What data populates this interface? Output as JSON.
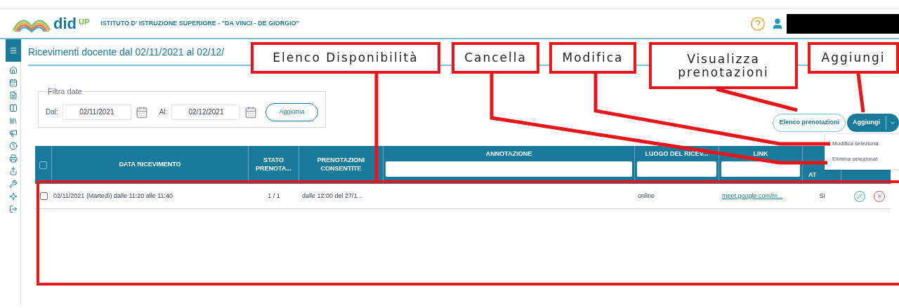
{
  "header": {
    "logo_text": "did",
    "logo_sup": "UP",
    "school": "ISTITUTO D' ISTRUZIONE SUPERIORE - \"DA VINCI - DE GIORGIO\""
  },
  "page_title": "Ricevimenti docente dal 02/11/2021 al 02/12/",
  "filter": {
    "legend": "Filtra date",
    "from_label": "Dal:",
    "from": "02/11/2021",
    "to_label": "Al:",
    "to": "02/12/2021",
    "button": "Aggiorna"
  },
  "actions": {
    "list_button": "Elenco prenotazioni",
    "add_button": "Aggiungi",
    "menu": [
      "Modifica seleziona",
      "Elimina selezionat"
    ]
  },
  "table": {
    "select_all_checked": false,
    "columns": [
      {
        "label": "DATA RICEVIMENTO",
        "filter": false
      },
      {
        "label": "STATO PRENOTA...",
        "filter": false
      },
      {
        "label": "PRENOTAZIONI CONSENTITE",
        "filter": false
      },
      {
        "label": "ANNOTAZIONE",
        "filter": true
      },
      {
        "label": "LUOGO DEL RICEV...",
        "filter": true
      },
      {
        "label": "LINK",
        "filter": true
      },
      {
        "label": "AT",
        "filter": false
      }
    ],
    "rows": [
      {
        "checked": false,
        "date": "02/11/2021 (Martedì) dalle 11:20 alle 11:40",
        "stato": "1 / 1",
        "prenotazioni": "dalle 12:00 del 27/1...",
        "luogo": "online",
        "link": "meet.google.com/m...",
        "column_8": "Si"
      }
    ]
  },
  "annotations": [
    "Elenco Disponibilità",
    "Cancella",
    "Modifica",
    "Visualizza prenotazioni",
    "Aggiungi"
  ]
}
